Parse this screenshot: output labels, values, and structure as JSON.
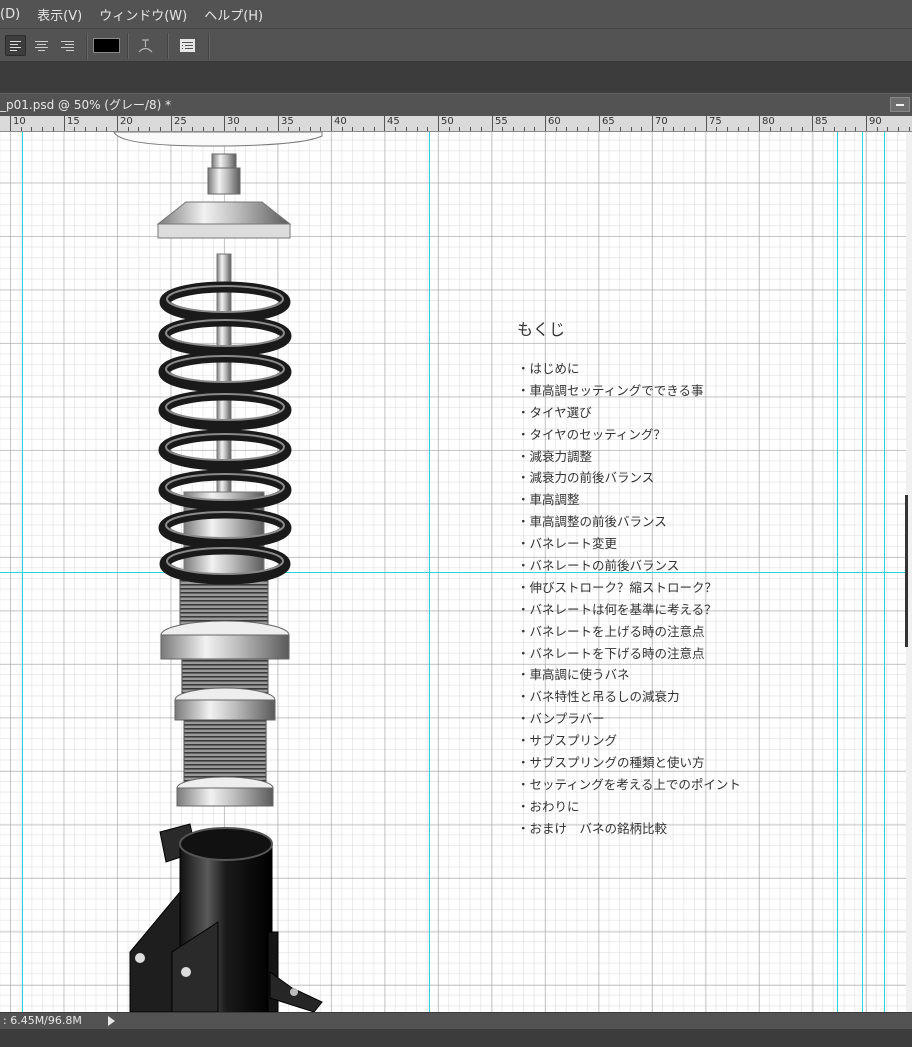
{
  "menu": {
    "items": [
      "(D)",
      "表示(V)",
      "ウィンドウ(W)",
      "ヘルプ(H)"
    ]
  },
  "options_bar": {
    "icons": [
      "align-left-icon",
      "align-center-icon",
      "align-right-icon",
      "text-color-swatch",
      "warp-text-icon",
      "character-panel-icon"
    ],
    "text_color": "#000000"
  },
  "document": {
    "tab_title": "_p01.psd @ 50% (グレー/8) *"
  },
  "ruler": {
    "labels": [
      "10",
      "15",
      "20",
      "25",
      "30",
      "35",
      "40",
      "45",
      "50",
      "55",
      "60",
      "65",
      "70",
      "75",
      "80",
      "85",
      "90"
    ]
  },
  "canvas": {
    "guide_color": "#25d4dc",
    "image": "coilover-suspension-illustration"
  },
  "toc": {
    "title": "もくじ",
    "items": [
      "・はじめに",
      "・車高調セッティングでできる事",
      "・タイヤ選び",
      "・タイヤのセッティング？",
      "・減衰力調整",
      "・減衰力の前後バランス",
      "・車高調整",
      "・車高調整の前後バランス",
      "・バネレート変更",
      "・バネレートの前後バランス",
      "・伸びストローク？縮ストローク？",
      "・バネレートは何を基準に考える？",
      "・バネレートを上げる時の注意点",
      "・バネレートを下げる時の注意点",
      "・車高調に使うバネ",
      "・バネ特性と吊るしの減衰力",
      "・バンプラバー",
      "・サブスプリング",
      "・サブスプリングの種類と使い方",
      "・セッティングを考える上でのポイント",
      "・おわりに",
      "・おまけ　バネの銘柄比較"
    ]
  },
  "status": {
    "doc_size": ": 6.45M/96.8M"
  }
}
